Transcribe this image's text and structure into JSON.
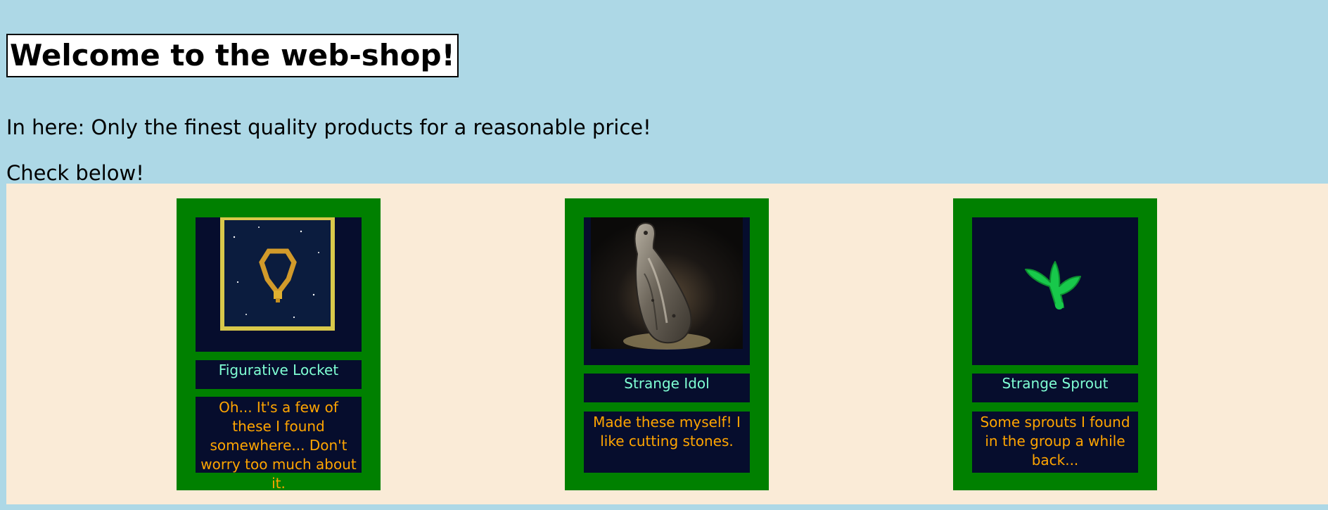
{
  "header": {
    "title": "Welcome to the web-shop!"
  },
  "intro": {
    "line1": "In here: Only the finest quality products for a reasonable price!",
    "line2": "Check below!"
  },
  "products": [
    {
      "name": "Figurative Locket",
      "description": "Oh... It's a few of these I found somewhere... Don't worry too much about it.",
      "icon": "locket-icon"
    },
    {
      "name": "Strange Idol",
      "description": "Made these myself! I like cutting stones.",
      "icon": "idol-icon"
    },
    {
      "name": "Strange Sprout",
      "description": "Some sprouts I found in the group a while back...",
      "icon": "sprout-icon"
    }
  ],
  "colors": {
    "page_background": "#add8e6",
    "shop_background": "#faebd7",
    "card_background": "#008000",
    "inner_box_background": "#060d2d",
    "product_name_color": "#7fffd4",
    "description_color": "#ffa500",
    "locket_frame": "#d9c84a",
    "sprout_green": "#18c84b"
  }
}
